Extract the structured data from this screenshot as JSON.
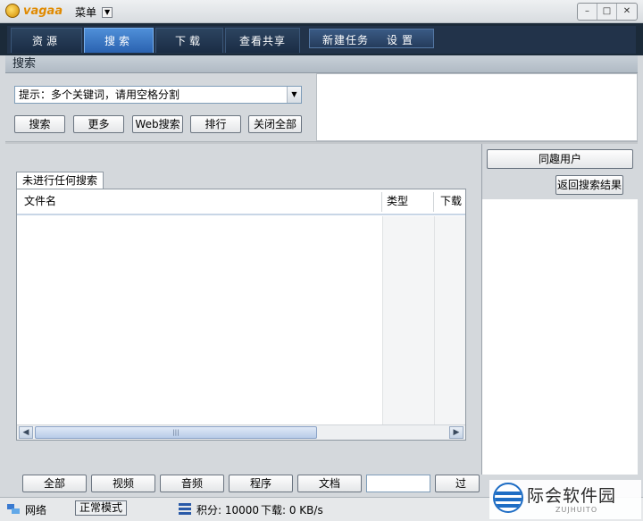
{
  "app": {
    "logo_text": "vagaa",
    "menu_label": "菜单"
  },
  "nav": {
    "tabs": [
      {
        "label": "资源",
        "active": false
      },
      {
        "label": "搜索",
        "active": true
      },
      {
        "label": "下载",
        "active": false
      },
      {
        "label": "查看共享",
        "active": false
      }
    ],
    "new_task": "新建任务",
    "settings": "设置"
  },
  "section_title": "搜索",
  "search": {
    "hint": "提示：多个关键词，请用空格分割",
    "buttons": [
      "搜索",
      "更多",
      "Web搜索",
      "排行",
      "关闭全部"
    ]
  },
  "right_panel": {
    "users_button": "同趣用户",
    "back_button": "返回搜索结果"
  },
  "results": {
    "tab_label": "未进行任何搜索",
    "columns": [
      "文件名",
      "类型",
      "下载"
    ]
  },
  "filters": {
    "buttons": [
      "全部",
      "视频",
      "音频",
      "程序",
      "文档"
    ],
    "next_button": "过"
  },
  "status": {
    "network": "网络",
    "mode": "正常模式",
    "points": "积分: 10000",
    "download": "下载: 0 KB/s"
  },
  "watermark": {
    "text": "际会软件园",
    "sub": "ZUJHUITO"
  },
  "colors": {
    "nav_bg": "#1b2a39",
    "tab_active": "#2a62b0"
  }
}
